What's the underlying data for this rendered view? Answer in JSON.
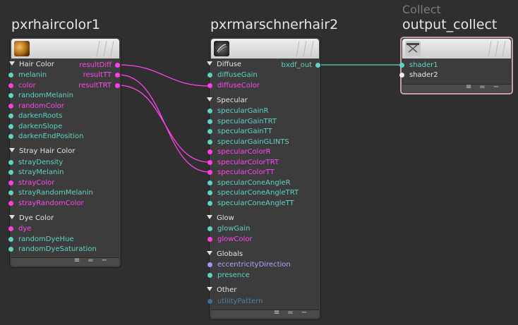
{
  "nodes": {
    "haircolor": {
      "title": "pxrhaircolor1",
      "groups": {
        "hair_color": "Hair Color",
        "stray": "Stray Hair Color",
        "dye": "Dye Color"
      },
      "outputs": [
        "resultDiff",
        "resultTT",
        "resultTRT"
      ],
      "inputs": {
        "melanin": "melanin",
        "color": "color",
        "randomMelanin": "randomMelanin",
        "randomColor": "randomColor",
        "darkenRoots": "darkenRoots",
        "darkenSlope": "darkenSlope",
        "darkenEndPosition": "darkenEndPosition",
        "strayDensity": "strayDensity",
        "strayMelanin": "strayMelanin",
        "strayColor": "strayColor",
        "strayRandomMelanin": "strayRandomMelanin",
        "strayRandomColor": "strayRandomColor",
        "dye": "dye",
        "randomDyeHue": "randomDyeHue",
        "randomDyeSaturation": "randomDyeSaturation"
      }
    },
    "marschner": {
      "title": "pxrmarschnerhair2",
      "output": "bxdf_out",
      "groups": {
        "diffuse": "Diffuse",
        "specular": "Specular",
        "glow": "Glow",
        "globals": "Globals",
        "other": "Other"
      },
      "inputs": {
        "diffuseGain": "diffuseGain",
        "diffuseColor": "diffuseColor",
        "specularGainR": "specularGainR",
        "specularGainTRT": "specularGainTRT",
        "specularGainTT": "specularGainTT",
        "specularGainGLINTS": "specularGainGLINTS",
        "specularColorR": "specularColorR",
        "specularColorTRT": "specularColorTRT",
        "specularColorTT": "specularColorTT",
        "specularConeAngleR": "specularConeAngleR",
        "specularConeAngleTRT": "specularConeAngleTRT",
        "specularConeAngleTT": "specularConeAngleTT",
        "glowGain": "glowGain",
        "glowColor": "glowColor",
        "eccentricityDirection": "eccentricityDirection",
        "presence": "presence",
        "utilityPattern": "utilityPattern"
      }
    },
    "collect": {
      "category": "Collect",
      "title": "output_collect",
      "inputs": [
        "shader1",
        "shader2"
      ]
    }
  },
  "colors": {
    "float_port": "#5ed3c3",
    "color_port": "#ff3ce6",
    "vector_port": "#9a9aee",
    "struct_port": "#3a6f98",
    "wire_color": "#ff44ee",
    "wire_bxdf": "#5ed3c3"
  },
  "icons": {
    "footer": [
      "list-icon",
      "equals-icon",
      "minus-icon"
    ]
  }
}
